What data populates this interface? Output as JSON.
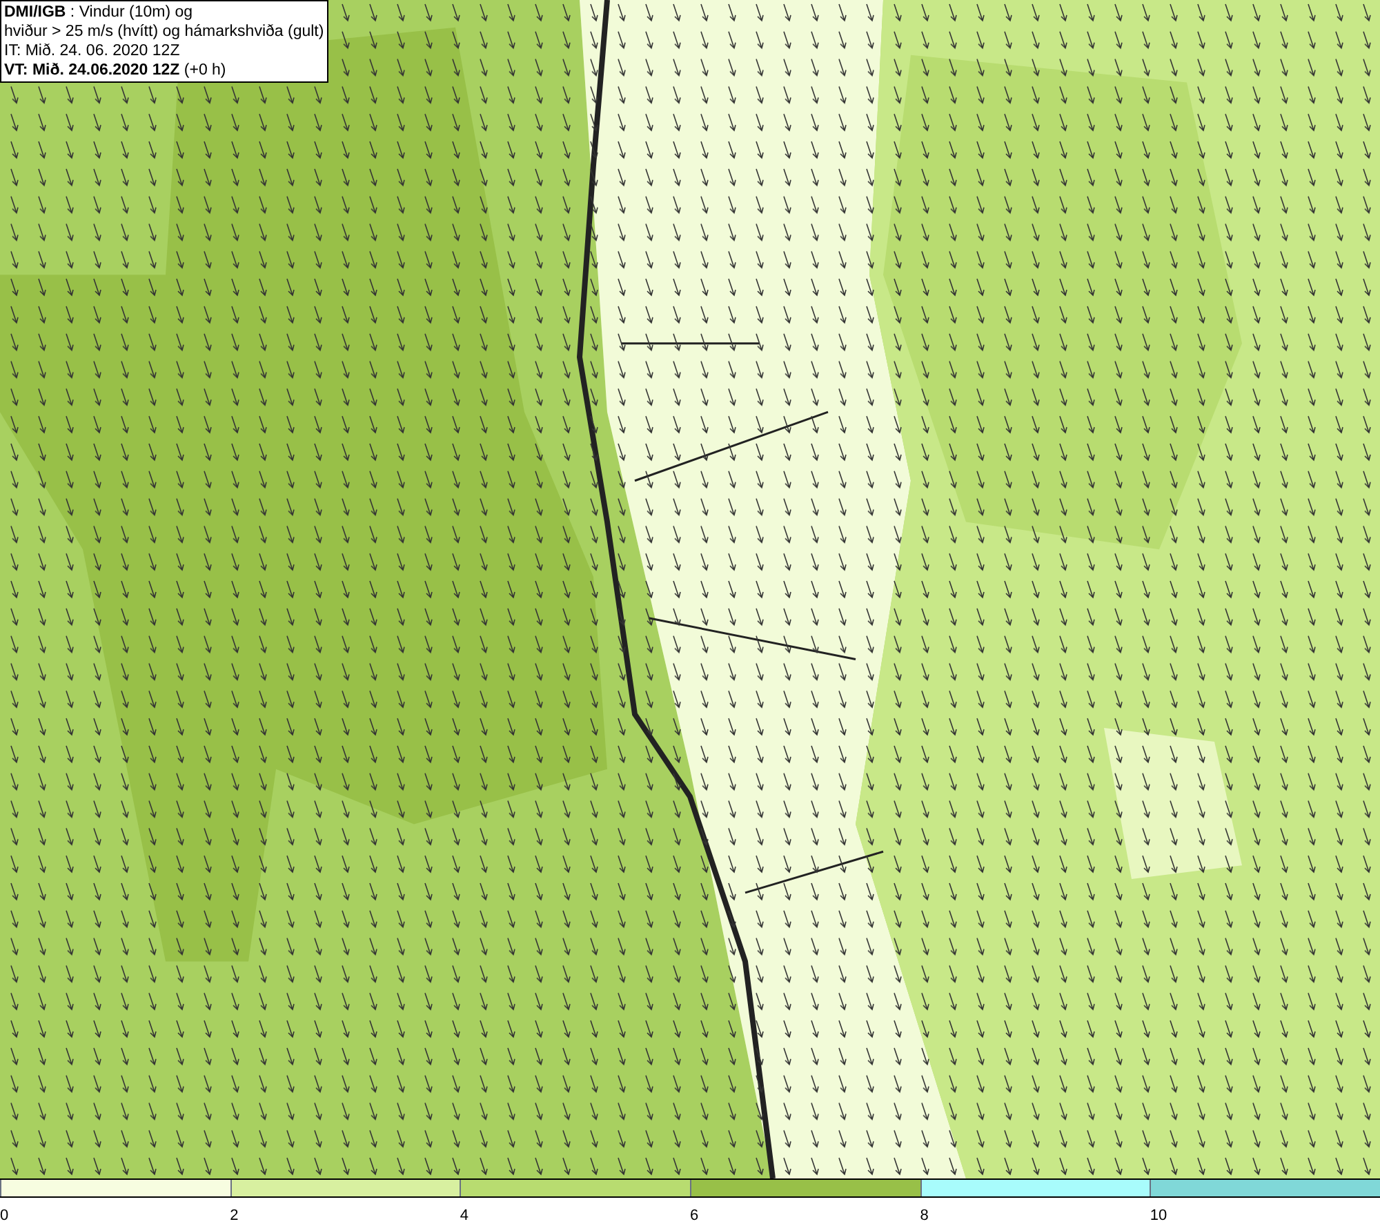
{
  "header": {
    "lines": [
      "**DMI/IGB** : Vindur (10m) og",
      "hviður > 25 m/s (hvítt) og hámarkshviða (gult)",
      "IT: Mið. 24. 06. 2020 12Z",
      "**VT: Mið. 24.06.2020 12Z** (+0 h)"
    ]
  },
  "legend": [
    {
      "label": "0",
      "color": "#f7fde0"
    },
    {
      "label": "2",
      "color": "#d8f0a0"
    },
    {
      "label": "4",
      "color": "#b8dc70"
    },
    {
      "label": "6",
      "color": "#98c048"
    },
    {
      "label": "8",
      "color": "#a8fcfc"
    },
    {
      "label": "10",
      "color": "#80d8d8"
    }
  ]
}
